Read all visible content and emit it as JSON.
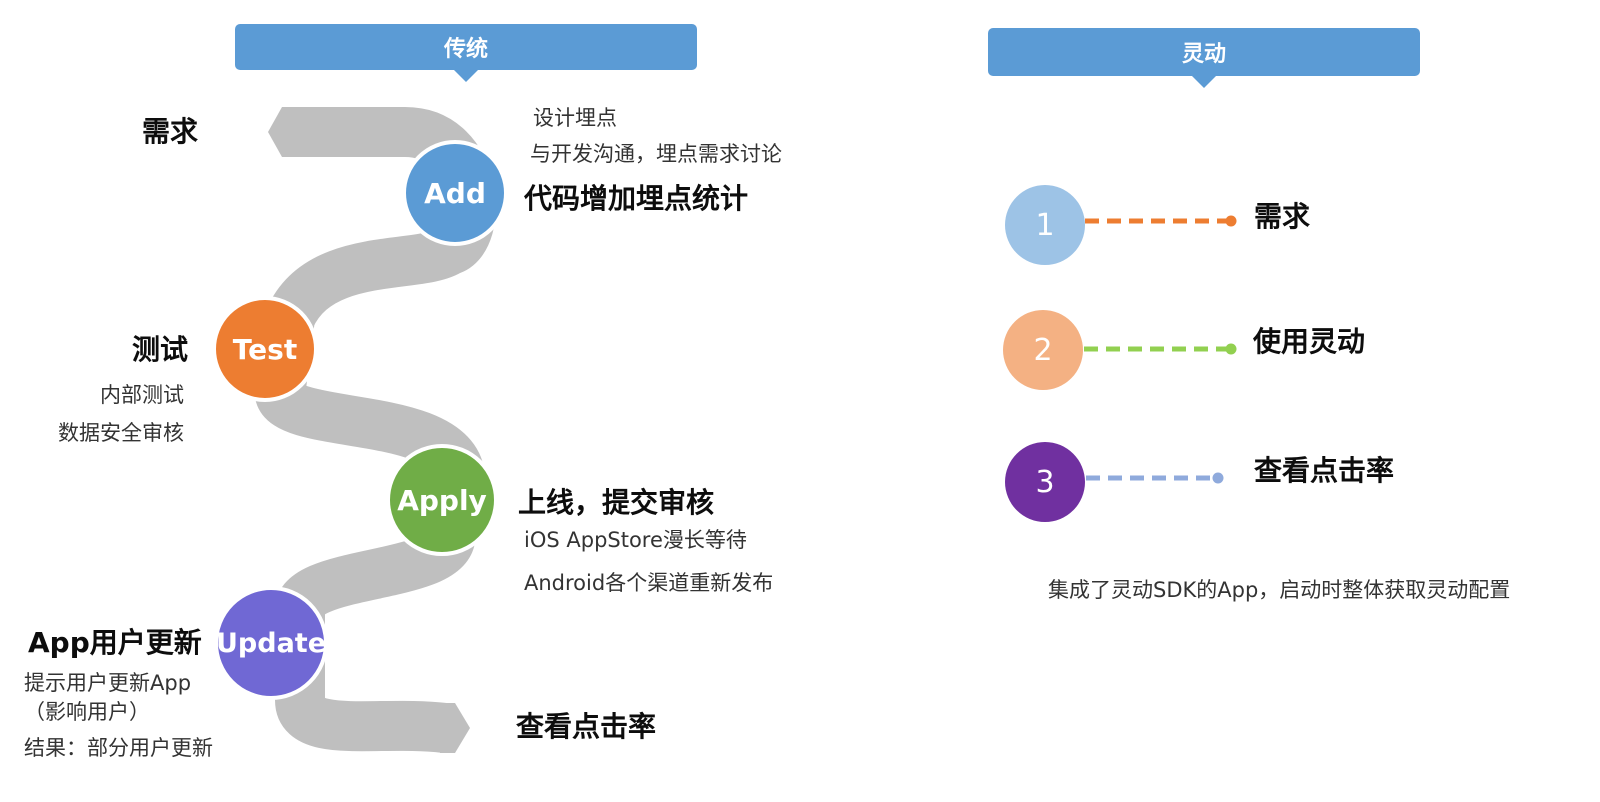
{
  "colors": {
    "header": "#5b9bd5",
    "track": "#bfbfbf",
    "add": "#5b9bd5",
    "test": "#ed7d31",
    "apply": "#70ad47",
    "update": "#7068d4",
    "step1": "#9dc3e6",
    "step2": "#f4b183",
    "step3": "#7030a0",
    "line1": "#ed7d31",
    "line2": "#92d050",
    "line3": "#8faadc"
  },
  "traditional": {
    "header": "传统",
    "start_label": "需求",
    "add": {
      "circle": "Add",
      "title": "代码增加埋点统计",
      "notes": [
        "设计埋点",
        "与开发沟通，埋点需求讨论"
      ]
    },
    "test": {
      "circle": "Test",
      "title": "测试",
      "notes": [
        "内部测试",
        "数据安全审核"
      ]
    },
    "apply": {
      "circle": "Apply",
      "title": "上线，提交审核",
      "notes": [
        "iOS AppStore漫长等待",
        "Android各个渠道重新发布"
      ]
    },
    "update": {
      "circle": "Update",
      "title": "App用户更新",
      "notes": [
        "提示用户更新App",
        "（影响用户）",
        "结果：部分用户更新"
      ]
    },
    "end_label": "查看点击率"
  },
  "agile": {
    "header": "灵动",
    "steps": [
      {
        "num": "1",
        "label": "需求"
      },
      {
        "num": "2",
        "label": "使用灵动"
      },
      {
        "num": "3",
        "label": "查看点击率"
      }
    ],
    "footnote": "集成了灵动SDK的App，启动时整体获取灵动配置"
  }
}
